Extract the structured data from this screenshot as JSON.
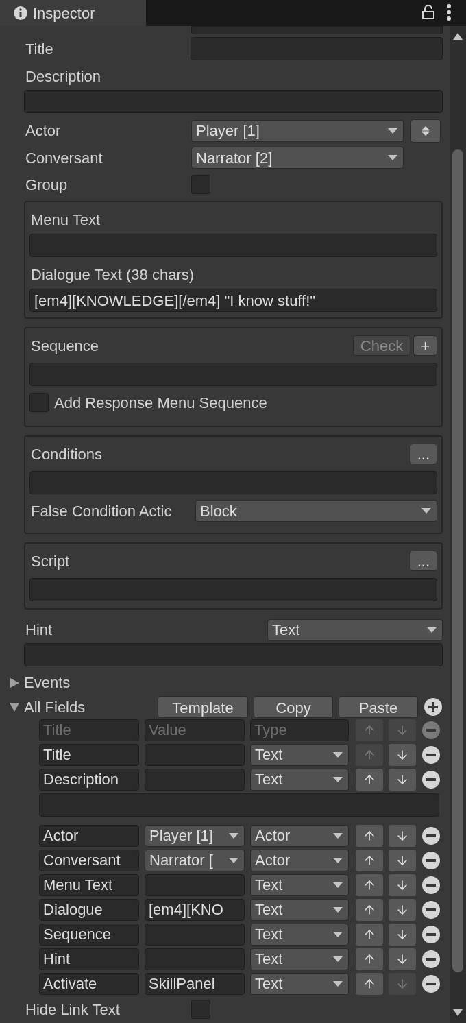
{
  "panel_tab": {
    "title": "Inspector"
  },
  "fields": [
    {
      "kind": "inline_field",
      "label": "Title"
    },
    {
      "kind": "block_field",
      "label": "Description"
    },
    {
      "kind": "dropdown",
      "label": "Actor",
      "value": "Player [1]",
      "stepper": true
    },
    {
      "kind": "dropdown",
      "label": "Conversant",
      "value": "Narrator [2]",
      "stepper": false
    },
    {
      "kind": "checkbox",
      "label": "Group",
      "checked": false
    }
  ],
  "text_group": [
    {
      "label": "Menu Text"
    },
    {
      "label": "Dialogue Text (38 chars)",
      "value": "[em4][KNOWLEDGE][/em4] \"I know stuff!\""
    }
  ],
  "sequence_group": {
    "title": "Sequence",
    "check_button": {
      "label": "Check",
      "disabled": true
    },
    "add_button": "+",
    "checkbox": {
      "label": "Add Response Menu Sequence",
      "checked": false
    }
  },
  "conditions_group": {
    "title": "Conditions",
    "more_button": "...",
    "action_label": "False Condition Actic",
    "action_value": "Block"
  },
  "script_group": {
    "title": "Script",
    "more_button": "..."
  },
  "hint": {
    "label": "Hint",
    "value": "Text"
  },
  "foldouts": [
    {
      "label": "Events",
      "expanded": false
    },
    {
      "label": "All Fields",
      "expanded": true
    }
  ],
  "all_fields": {
    "buttons": [
      "Template",
      "Copy",
      "Paste"
    ],
    "rows": [
      {
        "kind": "header",
        "title_placeholder": "Title",
        "value_placeholder": "Value",
        "type_placeholder": "Type",
        "up_disabled": true,
        "down_disabled": true
      },
      {
        "kind": "text",
        "title": "Title",
        "type": "Text",
        "up_disabled": true,
        "down_disabled": false
      },
      {
        "kind": "text",
        "title": "Description",
        "type": "Text",
        "up_disabled": false,
        "down_disabled": false,
        "multiline": true
      },
      {
        "kind": "dropdown",
        "title": "Actor",
        "value": "Player [1]",
        "type": "Actor",
        "up_disabled": false,
        "down_disabled": false
      },
      {
        "kind": "dropdown",
        "title": "Conversant",
        "value": "Narrator [",
        "type": "Actor",
        "up_disabled": false,
        "down_disabled": false
      },
      {
        "kind": "text",
        "title": "Menu Text",
        "type": "Text",
        "up_disabled": false,
        "down_disabled": false
      },
      {
        "kind": "text",
        "title": "Dialogue",
        "value": "[em4][KNO",
        "type": "Text",
        "up_disabled": false,
        "down_disabled": false
      },
      {
        "kind": "text",
        "title": "Sequence",
        "type": "Text",
        "up_disabled": false,
        "down_disabled": false
      },
      {
        "kind": "text",
        "title": "Hint",
        "type": "Text",
        "up_disabled": false,
        "down_disabled": false
      },
      {
        "kind": "text",
        "title": "Activate",
        "value": "SkillPanel",
        "type": "Text",
        "up_disabled": false,
        "down_disabled": true
      }
    ]
  },
  "hide_link_text": {
    "label": "Hide Link Text",
    "checked": false
  }
}
